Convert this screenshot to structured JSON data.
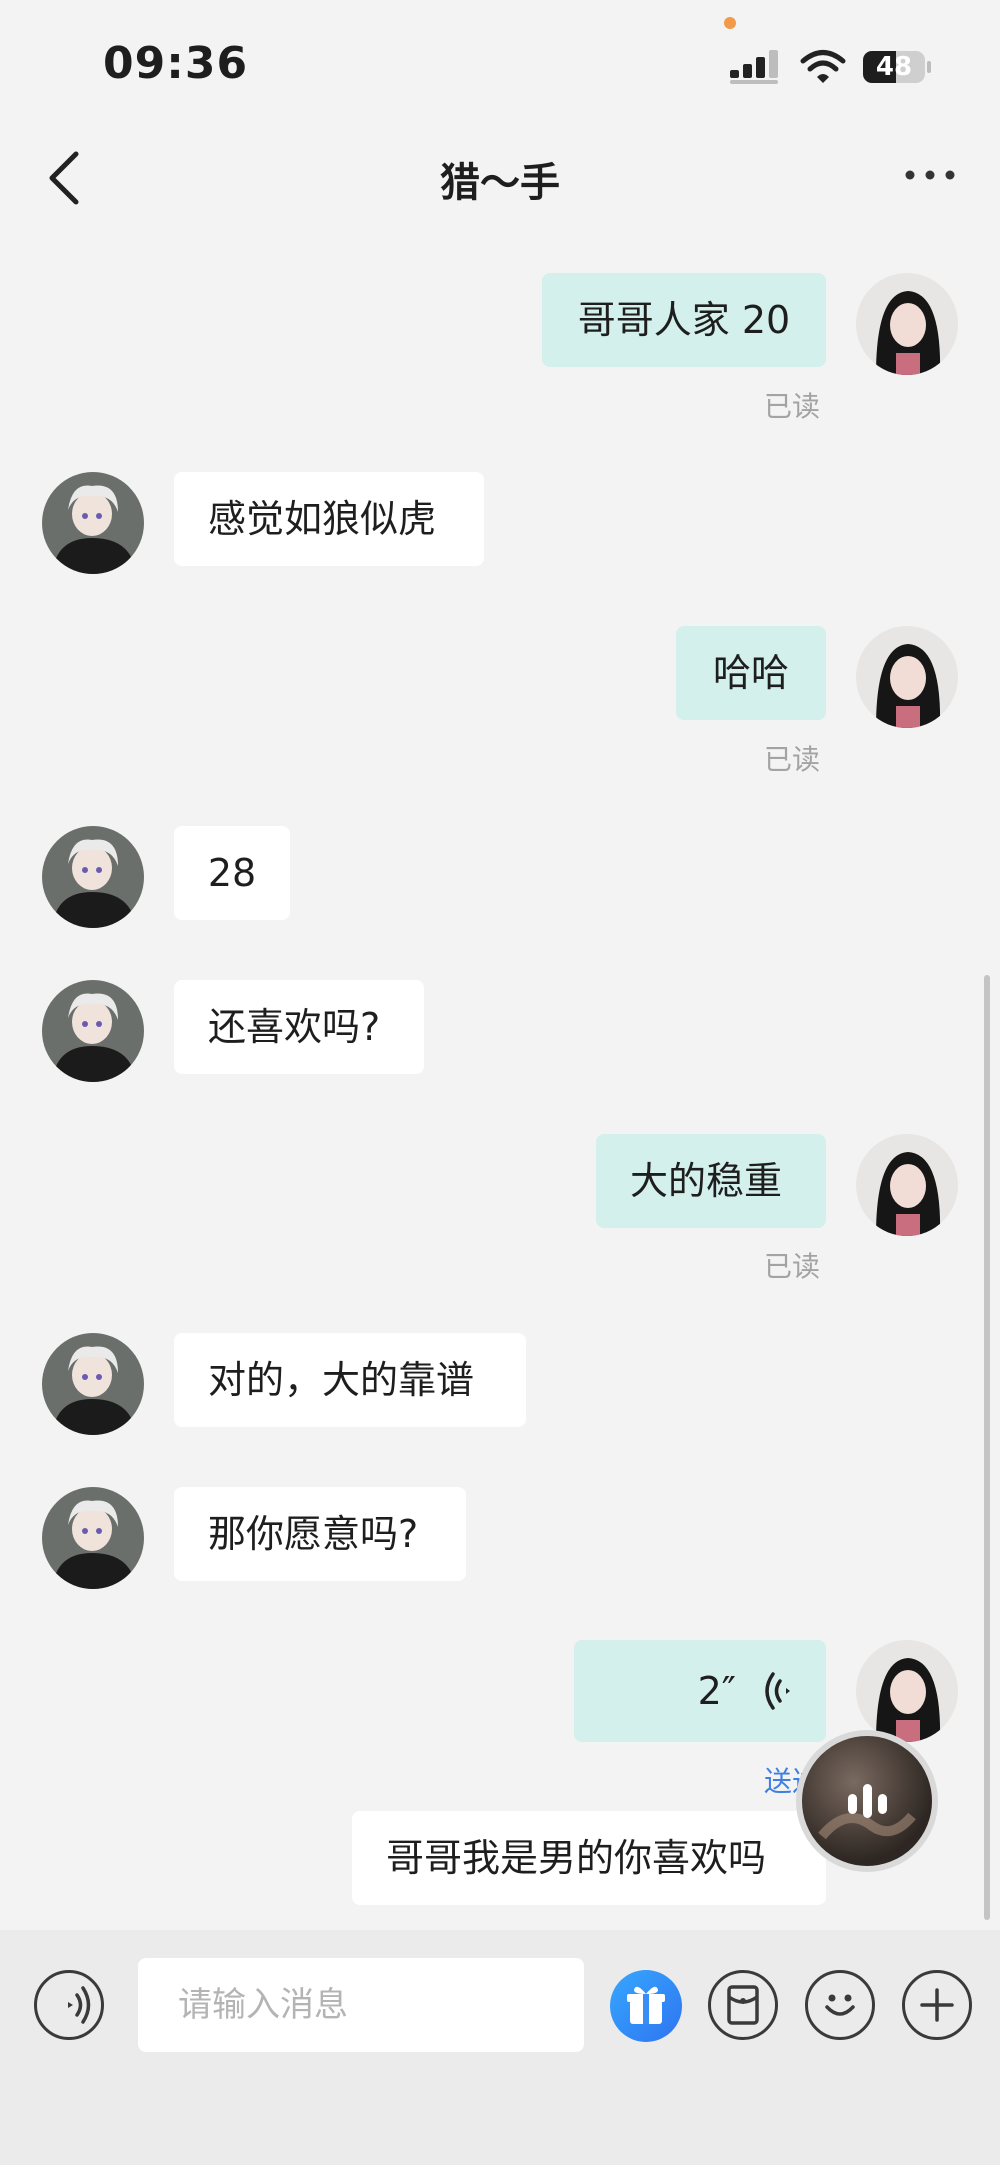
{
  "status": {
    "time": "09:36",
    "battery": "48"
  },
  "nav": {
    "title": "猎～手"
  },
  "messages": [
    {
      "side": "me",
      "text": "哥哥人家 20",
      "status": "已读"
    },
    {
      "side": "other",
      "text": "感觉如狼似虎"
    },
    {
      "side": "me",
      "text": "哈哈",
      "status": "已读"
    },
    {
      "side": "other",
      "text": "28"
    },
    {
      "side": "other",
      "text": "还喜欢吗?"
    },
    {
      "side": "me",
      "text": "大的稳重",
      "status": "已读"
    },
    {
      "side": "other",
      "text": "对的，大的靠谱"
    },
    {
      "side": "other",
      "text": "那你愿意吗?"
    },
    {
      "side": "me",
      "type": "voice",
      "duration": "2″",
      "status": "送达"
    },
    {
      "side": "me",
      "text": "哥哥我是男的你喜欢吗"
    }
  ],
  "composer": {
    "placeholder": "请输入消息"
  },
  "colors": {
    "my_bubble": "#d3f0ec",
    "other_bubble": "#ffffff",
    "background": "#f3f3f3",
    "sent_status": "#3f7fe0"
  },
  "icons": [
    "back-arrow-icon",
    "more-dots-icon",
    "voice-toggle-icon",
    "gift-icon",
    "red-packet-icon",
    "emoji-icon",
    "plus-icon",
    "voice-wave-icon"
  ]
}
